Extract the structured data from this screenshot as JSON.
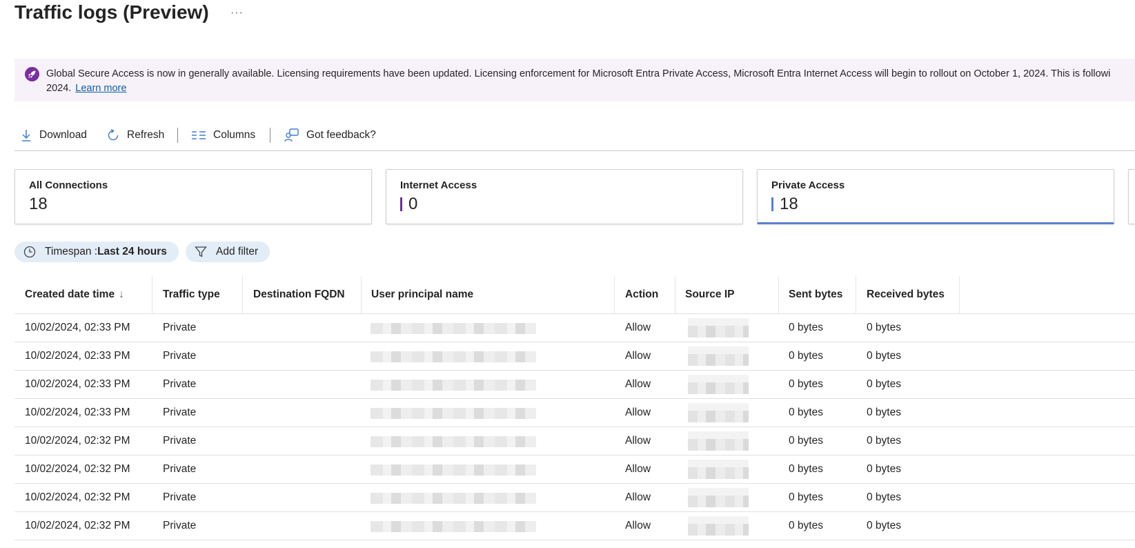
{
  "header": {
    "title": "Traffic logs (Preview)",
    "more_label": "···"
  },
  "banner": {
    "icon": "rocket-icon",
    "text_line1": "Global Secure Access is now in generally available. Licensing requirements have been updated. Licensing enforcement for Microsoft Entra Private Access, Microsoft Entra Internet Access will begin to rollout on October 1, 2024. This is followi",
    "text_line2": "2024.",
    "link_label": "Learn more"
  },
  "toolbar": {
    "download_label": "Download",
    "refresh_label": "Refresh",
    "columns_label": "Columns",
    "feedback_label": "Got feedback?"
  },
  "cards": [
    {
      "label": "All Connections",
      "value": "18"
    },
    {
      "label": "Internet Access",
      "value": "0",
      "bar_color": "#6b2ca3"
    },
    {
      "label": "Private Access",
      "value": "18",
      "bar_color": "#5b7fce"
    }
  ],
  "filters": {
    "timespan_prefix": "Timespan : ",
    "timespan_value": "Last 24 hours",
    "add_filter_label": "Add filter"
  },
  "table": {
    "columns": [
      "Created date time",
      "Traffic type",
      "Destination FQDN",
      "User principal name",
      "Action",
      "Source IP",
      "Sent bytes",
      "Received bytes"
    ],
    "sort_indicator": "↓",
    "rows": [
      {
        "created": "10/02/2024, 02:33 PM",
        "type": "Private",
        "fqdn": "",
        "action": "Allow",
        "sent": "0 bytes",
        "received": "0 bytes"
      },
      {
        "created": "10/02/2024, 02:33 PM",
        "type": "Private",
        "fqdn": "",
        "action": "Allow",
        "sent": "0 bytes",
        "received": "0 bytes"
      },
      {
        "created": "10/02/2024, 02:33 PM",
        "type": "Private",
        "fqdn": "",
        "action": "Allow",
        "sent": "0 bytes",
        "received": "0 bytes"
      },
      {
        "created": "10/02/2024, 02:33 PM",
        "type": "Private",
        "fqdn": "",
        "action": "Allow",
        "sent": "0 bytes",
        "received": "0 bytes"
      },
      {
        "created": "10/02/2024, 02:32 PM",
        "type": "Private",
        "fqdn": "",
        "action": "Allow",
        "sent": "0 bytes",
        "received": "0 bytes"
      },
      {
        "created": "10/02/2024, 02:32 PM",
        "type": "Private",
        "fqdn": "",
        "action": "Allow",
        "sent": "0 bytes",
        "received": "0 bytes"
      },
      {
        "created": "10/02/2024, 02:32 PM",
        "type": "Private",
        "fqdn": "",
        "action": "Allow",
        "sent": "0 bytes",
        "received": "0 bytes"
      },
      {
        "created": "10/02/2024, 02:32 PM",
        "type": "Private",
        "fqdn": "",
        "action": "Allow",
        "sent": "0 bytes",
        "received": "0 bytes"
      }
    ]
  },
  "colors": {
    "accent": "#5b7fce",
    "banner_bg": "#f7f2fa",
    "banner_icon": "#7a2fa0",
    "link": "#115ea3",
    "pill_bg": "#e3edf8"
  }
}
